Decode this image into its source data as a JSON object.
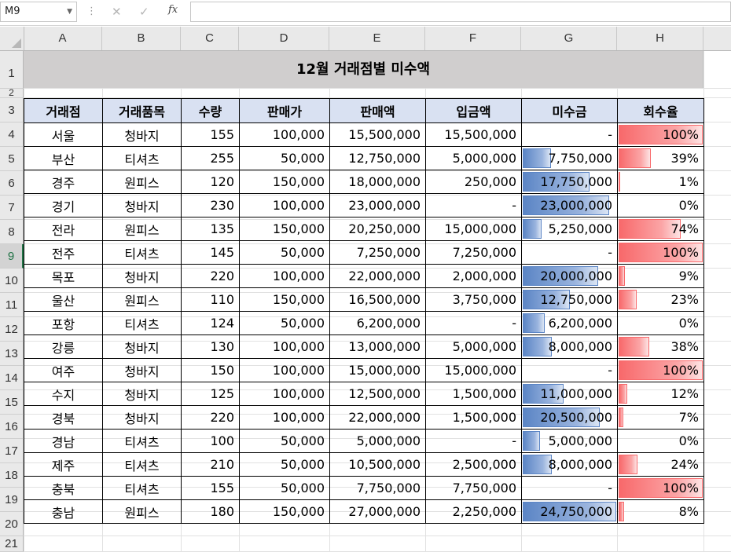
{
  "formula_bar": {
    "name_box": "M9",
    "formula": ""
  },
  "columns": [
    "A",
    "B",
    "C",
    "D",
    "E",
    "F",
    "G",
    "H"
  ],
  "rows": [
    "1",
    "2",
    "3",
    "4",
    "5",
    "6",
    "7",
    "8",
    "9",
    "10",
    "11",
    "12",
    "13",
    "14",
    "15",
    "16",
    "17",
    "18",
    "19",
    "20",
    "21"
  ],
  "selected_row": "9",
  "title": "12월 거래점별 미수액",
  "headers": [
    "거래점",
    "거래품목",
    "수량",
    "판매가",
    "판매액",
    "입금액",
    "미수금",
    "회수율"
  ],
  "table": [
    {
      "store": "서울",
      "item": "청바지",
      "qty": "155",
      "price": "100,000",
      "sales": "15,500,000",
      "paid": "15,500,000",
      "unpaid": "-",
      "unpaid_ratio": 0,
      "rate": "100%",
      "rate_value": 1.0
    },
    {
      "store": "부산",
      "item": "티셔츠",
      "qty": "255",
      "price": "50,000",
      "sales": "12,750,000",
      "paid": "5,000,000",
      "unpaid": "7,750,000",
      "unpaid_ratio": 0.313,
      "rate": "39%",
      "rate_value": 0.39
    },
    {
      "store": "경주",
      "item": "원피스",
      "qty": "120",
      "price": "150,000",
      "sales": "18,000,000",
      "paid": "250,000",
      "unpaid": "17,750,000",
      "unpaid_ratio": 0.717,
      "rate": "1%",
      "rate_value": 0.01
    },
    {
      "store": "경기",
      "item": "청바지",
      "qty": "230",
      "price": "100,000",
      "sales": "23,000,000",
      "paid": "-",
      "unpaid": "23,000,000",
      "unpaid_ratio": 0.929,
      "rate": "0%",
      "rate_value": 0
    },
    {
      "store": "전라",
      "item": "원피스",
      "qty": "135",
      "price": "150,000",
      "sales": "20,250,000",
      "paid": "15,000,000",
      "unpaid": "5,250,000",
      "unpaid_ratio": 0.212,
      "rate": "74%",
      "rate_value": 0.74
    },
    {
      "store": "전주",
      "item": "티셔츠",
      "qty": "145",
      "price": "50,000",
      "sales": "7,250,000",
      "paid": "7,250,000",
      "unpaid": "-",
      "unpaid_ratio": 0,
      "rate": "100%",
      "rate_value": 1.0
    },
    {
      "store": "목포",
      "item": "청바지",
      "qty": "220",
      "price": "100,000",
      "sales": "22,000,000",
      "paid": "2,000,000",
      "unpaid": "20,000,000",
      "unpaid_ratio": 0.808,
      "rate": "9%",
      "rate_value": 0.09
    },
    {
      "store": "울산",
      "item": "원피스",
      "qty": "110",
      "price": "150,000",
      "sales": "16,500,000",
      "paid": "3,750,000",
      "unpaid": "12,750,000",
      "unpaid_ratio": 0.515,
      "rate": "23%",
      "rate_value": 0.23
    },
    {
      "store": "포항",
      "item": "티셔츠",
      "qty": "124",
      "price": "50,000",
      "sales": "6,200,000",
      "paid": "-",
      "unpaid": "6,200,000",
      "unpaid_ratio": 0.25,
      "rate": "0%",
      "rate_value": 0
    },
    {
      "store": "강릉",
      "item": "청바지",
      "qty": "130",
      "price": "100,000",
      "sales": "13,000,000",
      "paid": "5,000,000",
      "unpaid": "8,000,000",
      "unpaid_ratio": 0.323,
      "rate": "38%",
      "rate_value": 0.38
    },
    {
      "store": "여주",
      "item": "청바지",
      "qty": "150",
      "price": "100,000",
      "sales": "15,000,000",
      "paid": "15,000,000",
      "unpaid": "-",
      "unpaid_ratio": 0,
      "rate": "100%",
      "rate_value": 1.0
    },
    {
      "store": "수지",
      "item": "청바지",
      "qty": "125",
      "price": "100,000",
      "sales": "12,500,000",
      "paid": "1,500,000",
      "unpaid": "11,000,000",
      "unpaid_ratio": 0.444,
      "rate": "12%",
      "rate_value": 0.12
    },
    {
      "store": "경북",
      "item": "청바지",
      "qty": "220",
      "price": "100,000",
      "sales": "22,000,000",
      "paid": "1,500,000",
      "unpaid": "20,500,000",
      "unpaid_ratio": 0.828,
      "rate": "7%",
      "rate_value": 0.07
    },
    {
      "store": "경남",
      "item": "티셔츠",
      "qty": "100",
      "price": "50,000",
      "sales": "5,000,000",
      "paid": "-",
      "unpaid": "5,000,000",
      "unpaid_ratio": 0.202,
      "rate": "0%",
      "rate_value": 0
    },
    {
      "store": "제주",
      "item": "티셔츠",
      "qty": "210",
      "price": "50,000",
      "sales": "10,500,000",
      "paid": "2,500,000",
      "unpaid": "8,000,000",
      "unpaid_ratio": 0.323,
      "rate": "24%",
      "rate_value": 0.24
    },
    {
      "store": "충북",
      "item": "티셔츠",
      "qty": "155",
      "price": "50,000",
      "sales": "7,750,000",
      "paid": "7,750,000",
      "unpaid": "-",
      "unpaid_ratio": 0,
      "rate": "100%",
      "rate_value": 1.0
    },
    {
      "store": "충남",
      "item": "원피스",
      "qty": "180",
      "price": "150,000",
      "sales": "27,000,000",
      "paid": "2,250,000",
      "unpaid": "24,750,000",
      "unpaid_ratio": 1.0,
      "rate": "8%",
      "rate_value": 0.08
    }
  ],
  "colors": {
    "header_fill": "#d9e1f2",
    "title_fill": "#d0cece",
    "bar_blue": "#5b85c5",
    "bar_red": "#f8696b"
  }
}
